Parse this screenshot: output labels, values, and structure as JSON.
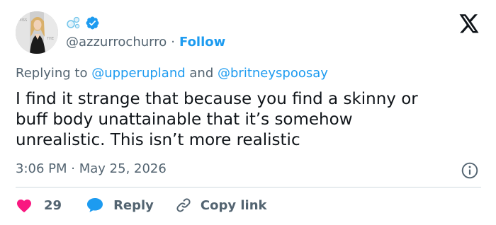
{
  "account": {
    "handle": "@azzurrochurro",
    "separator": "·",
    "follow_label": "Follow",
    "avatar_icon": "user-avatar-photo",
    "verified_icon": "verified-badge-icon",
    "emoji_icon": "bubbles-emoji-icon"
  },
  "reply_context": {
    "prefix": "Replying to",
    "mention_1": "@upperupland",
    "conjunction": "and",
    "mention_2": "@britneyspoosay"
  },
  "tweet": {
    "lines": [
      "I find it strange that because you find a skinny or",
      "buff body unattainable that it’s somehow",
      "unrealistic. This isn’t more realistic"
    ],
    "time": "3:06 PM",
    "separator": "·",
    "date": "May 25, 2026"
  },
  "actions": {
    "like_count": "29",
    "reply_label": "Reply",
    "copy_label": "Copy link"
  },
  "colors": {
    "accent": "#1d9bf0",
    "like": "#f91880",
    "secondary_text": "#536471",
    "primary_text": "#0f1419",
    "divider": "#cfd9de"
  },
  "icons": {
    "brand": "x-logo-icon",
    "info": "info-icon",
    "like": "heart-icon",
    "reply": "speech-bubble-icon",
    "copy": "link-icon"
  }
}
